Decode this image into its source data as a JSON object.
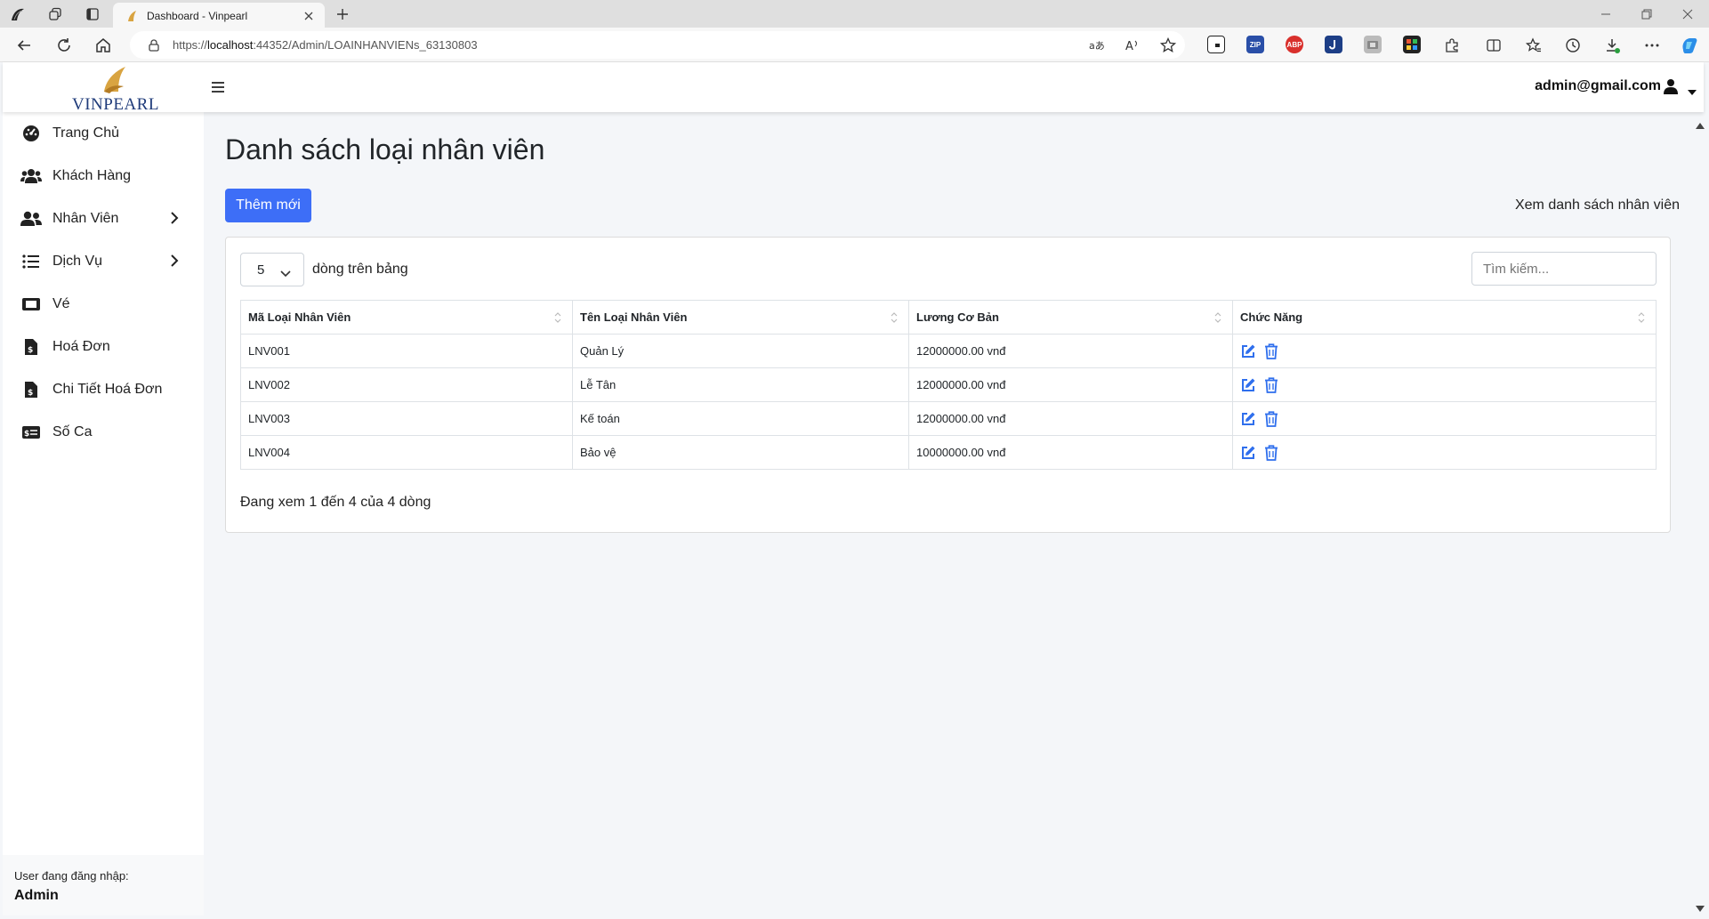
{
  "browser": {
    "tab_title": "Dashboard - Vinpearl",
    "url_prefix": "https://",
    "url_host": "localhost",
    "url_rest": ":44352/Admin/LOAINHANVIENs_63130803",
    "extensions": [
      "ZIP",
      "ABP"
    ]
  },
  "header": {
    "logo_text": "VINPEARL",
    "user_email": "admin@gmail.com"
  },
  "sidebar": {
    "items": [
      {
        "label": "Trang Chủ",
        "icon": "dashboard-gauge-icon"
      },
      {
        "label": "Khách Hàng",
        "icon": "users-icon"
      },
      {
        "label": "Nhân Viên",
        "icon": "user-group-icon"
      },
      {
        "label": "Dịch Vụ",
        "icon": "list-icon"
      },
      {
        "label": "Vé",
        "icon": "ticket-icon"
      },
      {
        "label": "Hoá Đơn",
        "icon": "invoice-icon"
      },
      {
        "label": "Chi Tiết Hoá Đơn",
        "icon": "invoice-detail-icon"
      },
      {
        "label": "Số Ca",
        "icon": "money-card-icon"
      }
    ],
    "footer_label": "User đang đăng nhập:",
    "footer_user": "Admin"
  },
  "main": {
    "title": "Danh sách loại nhân viên",
    "add_button": "Thêm mới",
    "view_link": "Xem danh sách nhân viên",
    "page_length": "5",
    "page_length_label": "dòng trên bảng",
    "search_placeholder": "Tìm kiếm...",
    "columns": [
      "Mã Loại Nhân Viên",
      "Tên Loại Nhân Viên",
      "Lương Cơ Bản",
      "Chức Năng"
    ],
    "rows": [
      {
        "code": "LNV001",
        "name": "Quản Lý",
        "salary": "12000000.00 vnđ"
      },
      {
        "code": "LNV002",
        "name": "Lễ Tân",
        "salary": "12000000.00 vnđ"
      },
      {
        "code": "LNV003",
        "name": "Kế toán",
        "salary": "12000000.00 vnđ"
      },
      {
        "code": "LNV004",
        "name": "Bảo vệ",
        "salary": "10000000.00 vnđ"
      }
    ],
    "info": "Đang xem 1 đến 4 của 4 dòng"
  },
  "colors": {
    "primary": "#3d6ef7",
    "action_icon": "#2f6fed",
    "logo_blue": "#1f3b7a",
    "logo_gold": "#d9a441"
  }
}
